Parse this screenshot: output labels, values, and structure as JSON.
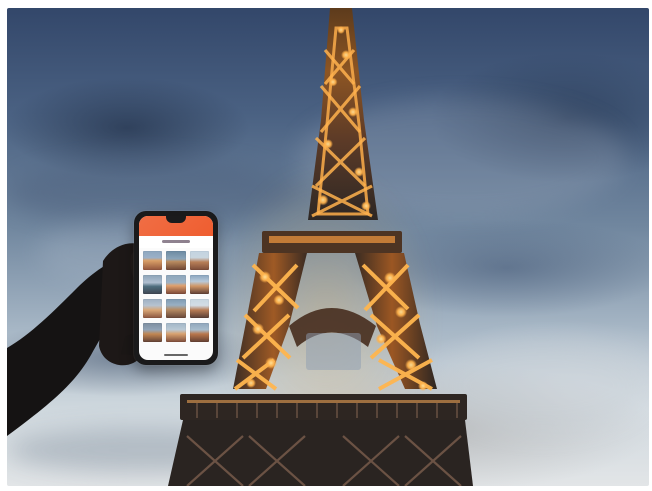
{
  "scene": {
    "subject": "",
    "phone_app": {
      "header_color": "#ef5d2f",
      "thumbnail_rows": 4,
      "thumbnail_columns": 3
    }
  },
  "icons": {
    "tower": "eiffel-tower-icon",
    "hand": "hand-icon",
    "phone": "smartphone-icon"
  },
  "colors": {
    "sky_top": "#33476a",
    "sky_mid": "#71879f",
    "sky_bottom": "#e2e5e7",
    "tower_lights": "#ffb04a",
    "tower_dark": "#2e2724",
    "phone_body": "#1a1a1b",
    "screen_bg": "#fbfbfb"
  }
}
